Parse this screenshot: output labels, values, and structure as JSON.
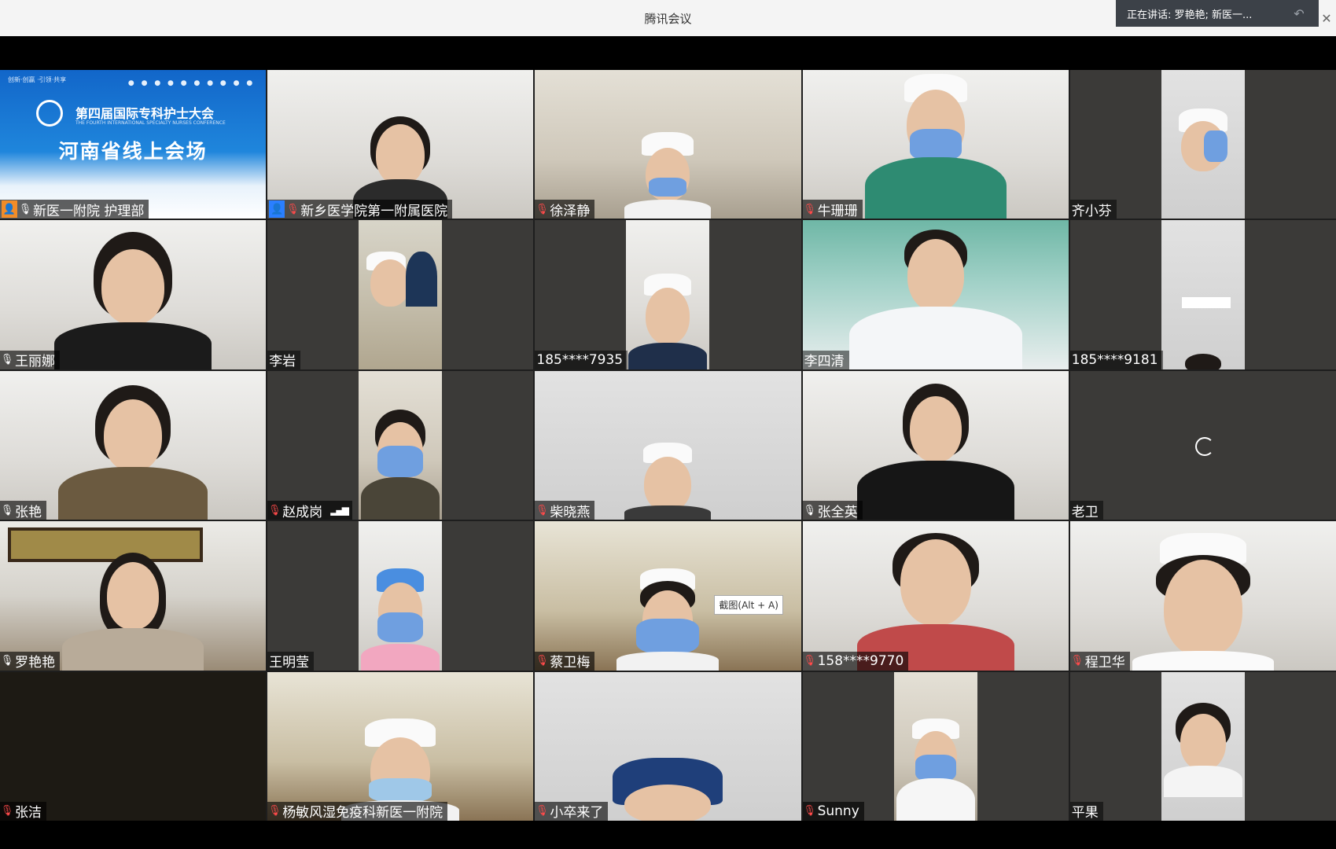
{
  "window": {
    "title": "腾讯会议",
    "speaking_text": "正在讲话: 罗艳艳; 新医一...",
    "undo_icon": "undo-icon",
    "close_icon": "close-icon"
  },
  "colors": {
    "active_speaker_border": "#2dbd6e",
    "muted_mic": "#ff4a4a",
    "host_badge": "#f28c28",
    "cohost_badge": "#2a7fff"
  },
  "banner": {
    "small_logos": "创新·创赢\n·引领·共享",
    "conference_title": "第四届国际专科护士大会",
    "conference_subtitle": "THE FOURTH INTERNATIONAL SPECIALTY NURSES CONFERENCE",
    "venue": "河南省线上会场"
  },
  "participants": [
    {
      "name": "新医一附院 护理部",
      "role": "host",
      "mic": "on"
    },
    {
      "name": "新乡医学院第一附属医院",
      "role": "cohost",
      "mic": "muted"
    },
    {
      "name": "徐泽静",
      "mic": "muted"
    },
    {
      "name": "牛珊珊",
      "mic": "muted"
    },
    {
      "name": "齐小芬",
      "mic": "none"
    },
    {
      "name": "王丽娜",
      "mic": "on"
    },
    {
      "name": "李岩",
      "mic": "none"
    },
    {
      "name": "185****7935",
      "mic": "none"
    },
    {
      "name": "李四清",
      "mic": "none"
    },
    {
      "name": "185****9181",
      "mic": "none"
    },
    {
      "name": "张艳",
      "mic": "on"
    },
    {
      "name": "赵成岗",
      "mic": "muted",
      "signal": true
    },
    {
      "name": "柴晓燕",
      "mic": "muted"
    },
    {
      "name": "张全英",
      "mic": "on"
    },
    {
      "name": "老卫",
      "mic": "none",
      "loading": true
    },
    {
      "name": "罗艳艳",
      "mic": "on",
      "active": true
    },
    {
      "name": "王明莹",
      "mic": "none"
    },
    {
      "name": "蔡卫梅",
      "mic": "muted",
      "tooltip": "截图(Alt + A)"
    },
    {
      "name": "158****9770",
      "mic": "muted"
    },
    {
      "name": "程卫华",
      "mic": "muted"
    },
    {
      "name": "张洁",
      "mic": "muted"
    },
    {
      "name": "杨敏风湿免疫科新医一附院",
      "mic": "muted"
    },
    {
      "name": "小卒来了",
      "mic": "muted"
    },
    {
      "name": "Sunny",
      "mic": "muted"
    },
    {
      "name": "平果",
      "mic": "none"
    }
  ]
}
